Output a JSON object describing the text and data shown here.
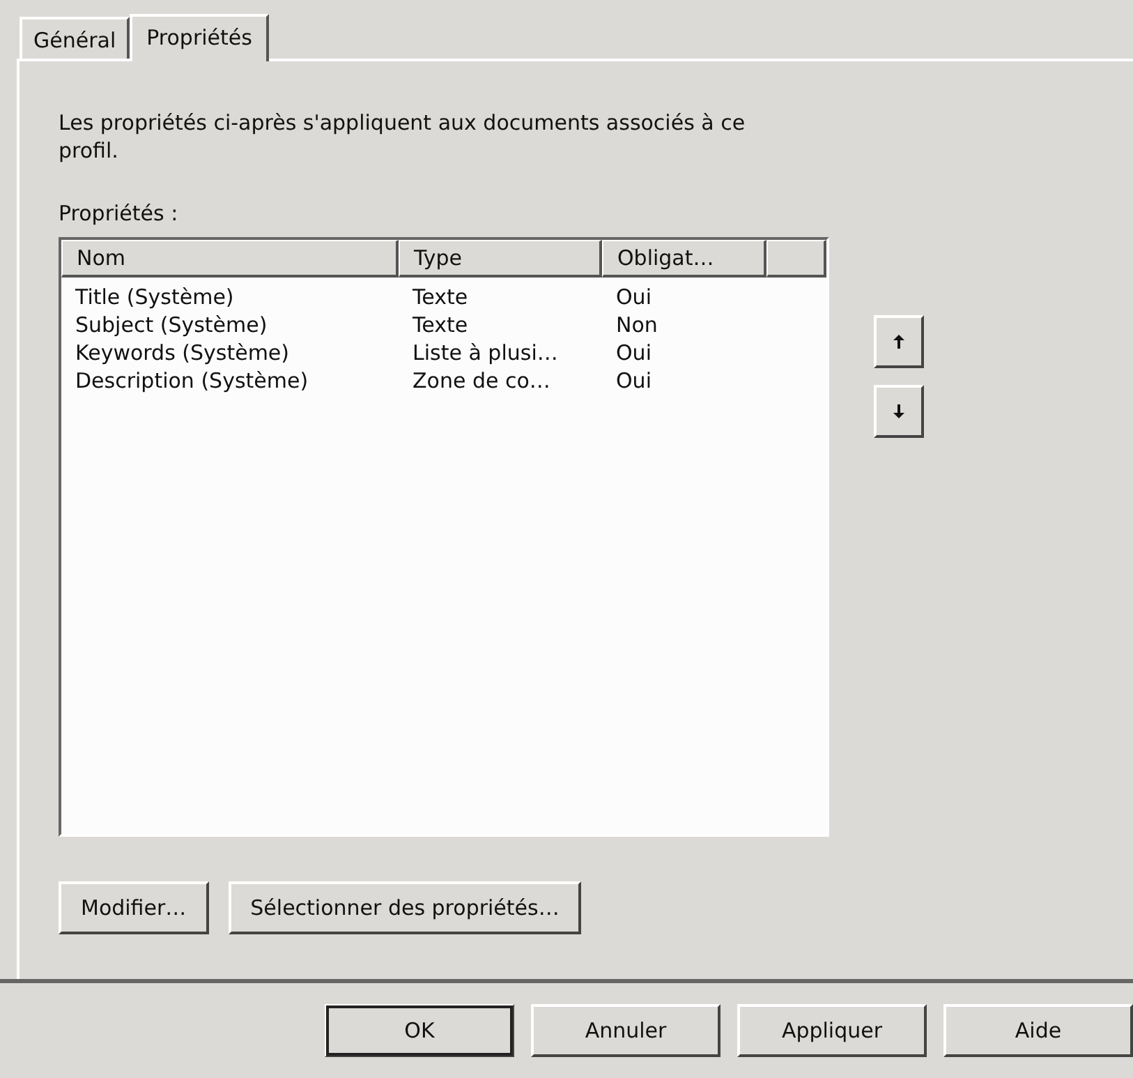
{
  "tabs": [
    {
      "label": "Général",
      "selected": false
    },
    {
      "label": "Propriétés",
      "selected": true
    }
  ],
  "description": "Les propriétés ci-après s'appliquent aux documents associés à ce profil.",
  "list_label": "Propriétés :",
  "table": {
    "columns": [
      "Nom",
      "Type",
      "Obligat…"
    ],
    "rows": [
      [
        "Title (Système)",
        "Texte",
        "Oui"
      ],
      [
        "Subject (Système)",
        "Texte",
        "Non"
      ],
      [
        "Keywords (Système)",
        "Liste à plusi…",
        "Oui"
      ],
      [
        "Description (Système)",
        "Zone de co…",
        "Oui"
      ]
    ]
  },
  "list_buttons": [
    "Modifier…",
    "Sélectionner des propriétés…"
  ],
  "dialog_buttons": [
    {
      "label": "OK",
      "default": true
    },
    {
      "label": "Annuler",
      "default": false
    },
    {
      "label": "Appliquer",
      "default": false
    },
    {
      "label": "Aide",
      "default": false
    }
  ]
}
